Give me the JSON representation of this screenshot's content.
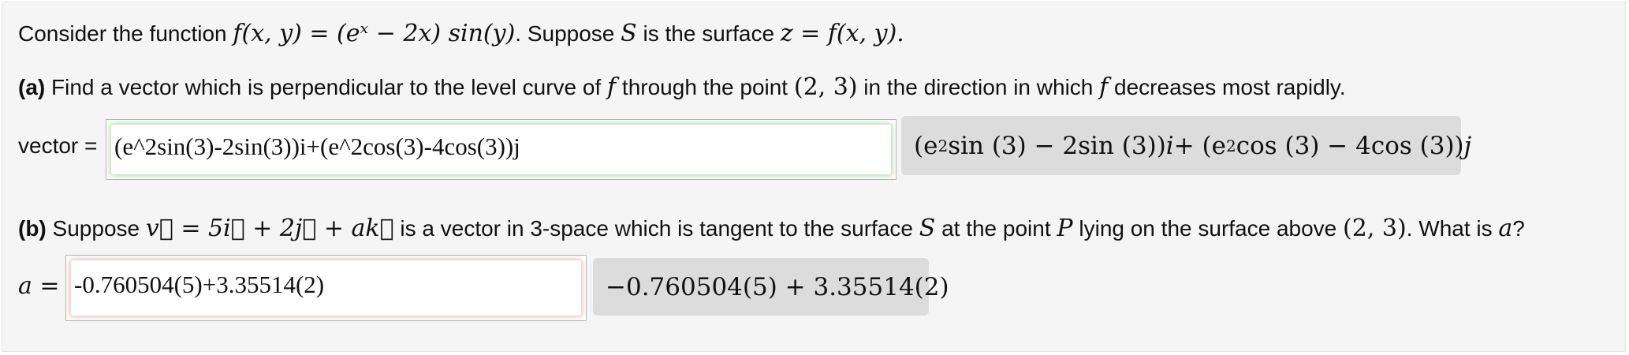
{
  "intro": {
    "text_before": "Consider the function ",
    "function_expr": "f(x, y) = (eˣ − 2x) sin(y)",
    "text_middle": ". Suppose ",
    "surface_var": "S",
    "text_after": " is the surface ",
    "surface_expr": "z = f(x, y)."
  },
  "part_a": {
    "tag": "(a)",
    "text1": " Find a vector which is perpendicular to the level curve of ",
    "f": "f",
    "text2": " through the point ",
    "point": "(2, 3)",
    "text3": " in the direction in which ",
    "text4": " decreases most rapidly.",
    "field_label": "vector =",
    "input_value": "(e^2sin(3)-2sin(3))i+(e^2cos(3)-4cos(3))j",
    "preview": {
      "p1": "(e",
      "sup1": "2",
      "p2": "sin (3) − 2sin (3))",
      "i": "i",
      "p3": " + (e",
      "sup2": "2",
      "p4": "cos (3) − 4cos (3))",
      "j": "j"
    }
  },
  "part_b": {
    "tag": "(b)",
    "text1": " Suppose ",
    "vector_expr": "v⃗ = 5i⃗ + 2j⃗ + ak⃗",
    "text2": " is a vector in 3-space which is tangent to the surface ",
    "S": "S",
    "text3": " at the point ",
    "P": "P",
    "text4": " lying on the surface above ",
    "point": "(2, 3)",
    "text5": ". What is ",
    "a": "a",
    "text6": "?",
    "field_label_var": "a",
    "field_label_eq": " =",
    "input_value": "-0.760504(5)+3.35514(2)",
    "preview": "−0.760504(5) + 3.35514(2)"
  }
}
